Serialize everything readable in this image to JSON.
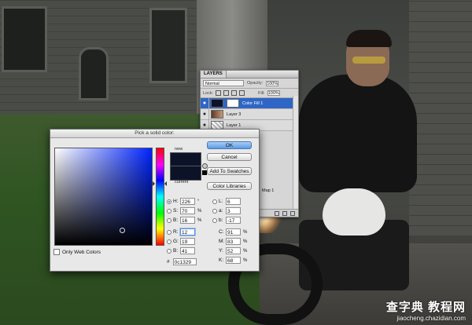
{
  "colors": {
    "selected": "#0c1329",
    "current": "#0c1329",
    "accent_blue": "#2f66c5"
  },
  "watermark": {
    "line1": "查字典 教程网",
    "line2": "jiaocheng.chazidian.com"
  },
  "layers_panel": {
    "tab": "LAYERS",
    "blend_mode": "Normal",
    "opacity_label": "Opacity:",
    "opacity_value": "100%",
    "lock_label": "Lock:",
    "fill_label": "Fill:",
    "fill_value": "100%",
    "layers": [
      {
        "name": "Color Fill 1",
        "selected": true
      },
      {
        "name": "Layer 3",
        "selected": false
      },
      {
        "name": "Layer 1",
        "selected": false
      }
    ],
    "bottom_partial_label": "Map 1"
  },
  "picker": {
    "title": "Pick a solid color:",
    "new_label": "new",
    "current_label": "current",
    "buttons": {
      "ok": "OK",
      "cancel": "Cancel",
      "add_to_swatches": "Add To Swatches",
      "color_libraries": "Color Libraries"
    },
    "hsb": {
      "h": {
        "label": "H:",
        "value": "226",
        "unit": "°"
      },
      "s": {
        "label": "S:",
        "value": "70",
        "unit": "%"
      },
      "b": {
        "label": "B:",
        "value": "16",
        "unit": "%"
      }
    },
    "rgb": {
      "r": {
        "label": "R:",
        "value": "12"
      },
      "g": {
        "label": "G:",
        "value": "19"
      },
      "b": {
        "label": "B:",
        "value": "41"
      }
    },
    "lab": {
      "l": {
        "label": "L:",
        "value": "6"
      },
      "a": {
        "label": "a:",
        "value": "3"
      },
      "b": {
        "label": "b:",
        "value": "-17"
      }
    },
    "cmyk": {
      "c": {
        "label": "C:",
        "value": "91",
        "unit": "%"
      },
      "m": {
        "label": "M:",
        "value": "83",
        "unit": "%"
      },
      "y": {
        "label": "Y:",
        "value": "52",
        "unit": "%"
      },
      "k": {
        "label": "K:",
        "value": "68",
        "unit": "%"
      }
    },
    "hex_label": "#",
    "hex_value": "0c1329",
    "only_web_colors": "Only Web Colors"
  }
}
